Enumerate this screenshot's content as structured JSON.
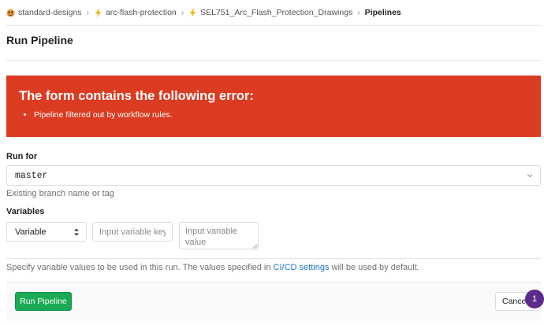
{
  "breadcrumb": [
    {
      "label": "standard-designs",
      "icon": "group-avatar-icon"
    },
    {
      "label": "arc-flash-protection",
      "icon": "lightning-icon"
    },
    {
      "label": "SEL751_Arc_Flash_Protection_Drawings",
      "icon": "lightning-icon"
    },
    {
      "label": "Pipelines",
      "icon": ""
    }
  ],
  "page_title": "Run Pipeline",
  "error": {
    "title": "The form contains the following error:",
    "items": [
      "Pipeline filtered out by workflow rules."
    ],
    "color": "#db3b21"
  },
  "run_for": {
    "label": "Run for",
    "selected": "master",
    "help": "Existing branch name or tag"
  },
  "variables": {
    "label": "Variables",
    "type_selected": "Variable",
    "key_placeholder": "Input variable key",
    "value_placeholder": "Input variable value",
    "help_prefix": "Specify variable values to be used in this run. The values specified in ",
    "help_link": "CI/CD settings",
    "help_suffix": " will be used by default."
  },
  "actions": {
    "run_label": "Run Pipeline",
    "cancel_label": "Cancel",
    "run_color": "#1aaa55"
  },
  "badge": {
    "count": "1",
    "color": "#5c2a8a"
  }
}
